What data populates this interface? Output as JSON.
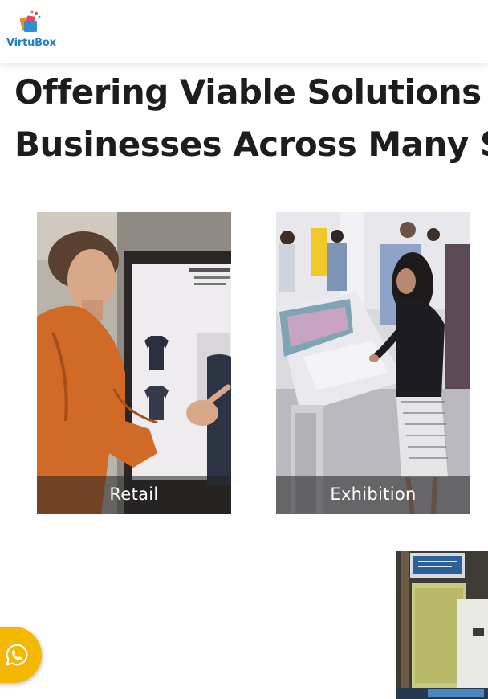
{
  "header": {
    "logo_text": "VirtuBox"
  },
  "hero": {
    "heading_line1": "Offering Viable Solutions to",
    "heading_line2": "Businesses Across Many Se"
  },
  "cards": [
    {
      "label": "Retail"
    },
    {
      "label": "Exhibition"
    }
  ],
  "floating": {
    "whatsapp_icon": "whatsapp-icon"
  },
  "colors": {
    "brand_blue": "#1f7fc0",
    "heading": "#1d1d1d",
    "whatsapp_bg": "#f5b800",
    "caption_overlay": "#232323"
  }
}
